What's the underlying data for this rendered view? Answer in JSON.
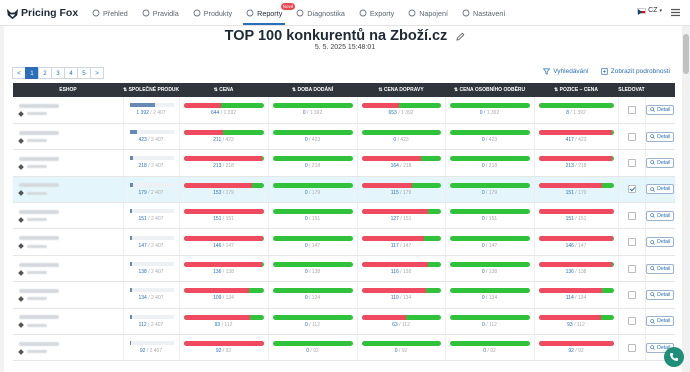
{
  "app": {
    "logo_text": "Pricing Fox"
  },
  "nav": [
    {
      "label": "Přehled",
      "icon": "home-icon",
      "active": false
    },
    {
      "label": "Pravidla",
      "icon": "rules-icon",
      "active": false
    },
    {
      "label": "Produkty",
      "icon": "cart-icon",
      "active": false
    },
    {
      "label": "Reporty",
      "icon": "report-icon",
      "active": true,
      "badge": "Nové"
    },
    {
      "label": "Diagnostika",
      "icon": "diagnostics-icon",
      "active": false
    },
    {
      "label": "Exporty",
      "icon": "export-icon",
      "active": false
    },
    {
      "label": "Napojení",
      "icon": "link-icon",
      "active": false
    },
    {
      "label": "Nastavení",
      "icon": "settings-icon",
      "active": false
    }
  ],
  "lang": {
    "code": "CZ"
  },
  "page": {
    "title": "TOP 100 konkurentů na Zboží.cz",
    "date": "5. 5. 2025 15:48:01"
  },
  "pager": {
    "pages": [
      "1",
      "2",
      "3",
      "4",
      "5"
    ],
    "current": "1",
    "prev": "<",
    "next": ">"
  },
  "actions": {
    "search": "Vyhledávání",
    "details": "Zobrazit podrobnosti"
  },
  "table": {
    "headers": [
      "ESHOP",
      "SPOLEČNÉ PRODUKTY",
      "CENA",
      "DOBA DODÁNÍ",
      "CENA DOPRAVY",
      "CENA OSOBNÍHO ODBĚRU",
      "POZICE – CENA",
      "SLEDOVAT",
      ""
    ],
    "detail_label": "Detail",
    "rows": [
      {
        "products": "1 392",
        "products_total": "2 407",
        "prod_frac": 0.58,
        "cena": [
          "644",
          "1 392"
        ],
        "doba": [
          "0",
          "1 392"
        ],
        "doprava": [
          "653",
          "1 392"
        ],
        "odber": [
          "0",
          "1 392"
        ],
        "pozice": [
          "8",
          "1 392"
        ],
        "watch": false
      },
      {
        "products": "423",
        "products_total": "2 407",
        "prod_frac": 0.18,
        "cena": [
          "211",
          "423"
        ],
        "doba": [
          "0",
          "423"
        ],
        "doprava": [
          "0",
          "423"
        ],
        "odber": [
          "0",
          "423"
        ],
        "pozice": [
          "417",
          "423"
        ],
        "watch": false
      },
      {
        "products": "218",
        "products_total": "2 407",
        "prod_frac": 0.09,
        "cena": [
          "213",
          "218"
        ],
        "doba": [
          "0",
          "218"
        ],
        "doprava": [
          "164",
          "218"
        ],
        "odber": [
          "0",
          "218"
        ],
        "pozice": [
          "213",
          "218"
        ],
        "watch": false
      },
      {
        "products": "179",
        "products_total": "2 407",
        "prod_frac": 0.07,
        "cena": [
          "153",
          "179"
        ],
        "doba": [
          "0",
          "179"
        ],
        "doprava": [
          "115",
          "179"
        ],
        "odber": [
          "0",
          "179"
        ],
        "pozice": [
          "151",
          "179"
        ],
        "watch": true
      },
      {
        "products": "151",
        "products_total": "2 407",
        "prod_frac": 0.06,
        "cena": [
          "151",
          "151"
        ],
        "doba": [
          "0",
          "151"
        ],
        "doprava": [
          "127",
          "151"
        ],
        "odber": [
          "0",
          "151"
        ],
        "pozice": [
          "151",
          "151"
        ],
        "watch": false
      },
      {
        "products": "147",
        "products_total": "2 407",
        "prod_frac": 0.06,
        "cena": [
          "146",
          "147"
        ],
        "doba": [
          "0",
          "147"
        ],
        "doprava": [
          "117",
          "147"
        ],
        "odber": [
          "0",
          "147"
        ],
        "pozice": [
          "146",
          "147"
        ],
        "watch": false
      },
      {
        "products": "138",
        "products_total": "2 407",
        "prod_frac": 0.06,
        "cena": [
          "136",
          "138"
        ],
        "doba": [
          "0",
          "138"
        ],
        "doprava": [
          "116",
          "138"
        ],
        "odber": [
          "0",
          "138"
        ],
        "pozice": [
          "136",
          "138"
        ],
        "watch": false
      },
      {
        "products": "134",
        "products_total": "2 407",
        "prod_frac": 0.06,
        "cena": [
          "109",
          "134"
        ],
        "doba": [
          "0",
          "134"
        ],
        "doprava": [
          "110",
          "134"
        ],
        "odber": [
          "0",
          "134"
        ],
        "pozice": [
          "114",
          "134"
        ],
        "watch": false
      },
      {
        "products": "112",
        "products_total": "2 407",
        "prod_frac": 0.05,
        "cena": [
          "93",
          "112"
        ],
        "doba": [
          "0",
          "112"
        ],
        "doprava": [
          "63",
          "112"
        ],
        "odber": [
          "0",
          "112"
        ],
        "pozice": [
          "93",
          "112"
        ],
        "watch": false
      },
      {
        "products": "92",
        "products_total": "2 407",
        "prod_frac": 0.04,
        "cena": [
          "92",
          "92"
        ],
        "doba": [
          "0",
          "92"
        ],
        "doprava": [
          "0",
          "92"
        ],
        "odber": [
          "0",
          "92"
        ],
        "pozice": [
          "92",
          "92"
        ],
        "watch": false
      }
    ]
  },
  "colors": {
    "brand": "#2a6fb7",
    "good": "#2fc23a",
    "bad": "#ef4a5f",
    "header": "#2f353a",
    "highlight": "#e4f6fb"
  }
}
